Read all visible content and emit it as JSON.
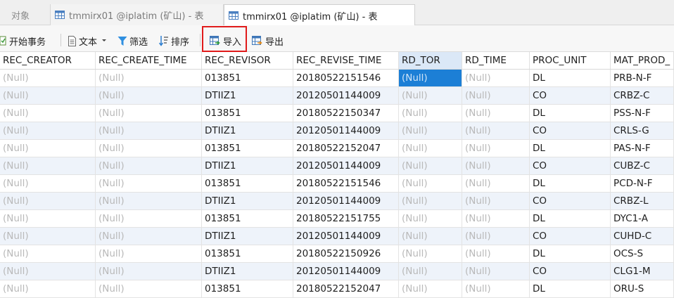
{
  "tabs": {
    "objects": "对象",
    "tab1": "tmmirx01 @iplatim (矿山) - 表",
    "tab2": "tmmirx01 @iplatim (矿山) - 表"
  },
  "toolbar": {
    "begin_transaction": "开始事务",
    "text": "文本",
    "filter": "筛选",
    "sort": "排序",
    "import": "导入",
    "export": "导出"
  },
  "colors": {
    "highlight_border": "#e01b1b",
    "selected_cell": "#1c7fd6",
    "alt_row": "#eef3fa"
  },
  "grid": {
    "columns": [
      "REC_CREATOR",
      "REC_CREATE_TIME",
      "REC_REVISOR",
      "REC_REVISE_TIME",
      "RD_TOR",
      "RD_TIME",
      "PROC_UNIT",
      "MAT_PROD_"
    ],
    "selected_column": "RD_TOR",
    "rows": [
      [
        "(Null)",
        "(Null)",
        "013851",
        "20180522151546",
        "(Null)",
        "(Null)",
        "DL",
        "PRB-N-F"
      ],
      [
        "(Null)",
        "(Null)",
        "DTIIZ1",
        "20120501144009",
        "(Null)",
        "(Null)",
        "CO",
        "CRBZ-C"
      ],
      [
        "(Null)",
        "(Null)",
        "013851",
        "20180522150347",
        "(Null)",
        "(Null)",
        "DL",
        "PSS-N-F"
      ],
      [
        "(Null)",
        "(Null)",
        "DTIIZ1",
        "20120501144009",
        "(Null)",
        "(Null)",
        "CO",
        "CRLS-G"
      ],
      [
        "(Null)",
        "(Null)",
        "013851",
        "20180522152047",
        "(Null)",
        "(Null)",
        "DL",
        "PAS-N-F"
      ],
      [
        "(Null)",
        "(Null)",
        "DTIIZ1",
        "20120501144009",
        "(Null)",
        "(Null)",
        "CO",
        "CUBZ-C"
      ],
      [
        "(Null)",
        "(Null)",
        "013851",
        "20180522151546",
        "(Null)",
        "(Null)",
        "DL",
        "PCD-N-F"
      ],
      [
        "(Null)",
        "(Null)",
        "DTIIZ1",
        "20120501144009",
        "(Null)",
        "(Null)",
        "CO",
        "CRBZ-L"
      ],
      [
        "(Null)",
        "(Null)",
        "013851",
        "20180522151755",
        "(Null)",
        "(Null)",
        "DL",
        "DYC1-A"
      ],
      [
        "(Null)",
        "(Null)",
        "DTIIZ1",
        "20120501144009",
        "(Null)",
        "(Null)",
        "CO",
        "CUHD-C"
      ],
      [
        "(Null)",
        "(Null)",
        "013851",
        "20180522150926",
        "(Null)",
        "(Null)",
        "DL",
        "OCS-S"
      ],
      [
        "(Null)",
        "(Null)",
        "DTIIZ1",
        "20120501144009",
        "(Null)",
        "(Null)",
        "CO",
        "CLG1-M"
      ],
      [
        "(Null)",
        "(Null)",
        "013851",
        "20180522152047",
        "(Null)",
        "(Null)",
        "DL",
        "ORU-S"
      ]
    ]
  }
}
